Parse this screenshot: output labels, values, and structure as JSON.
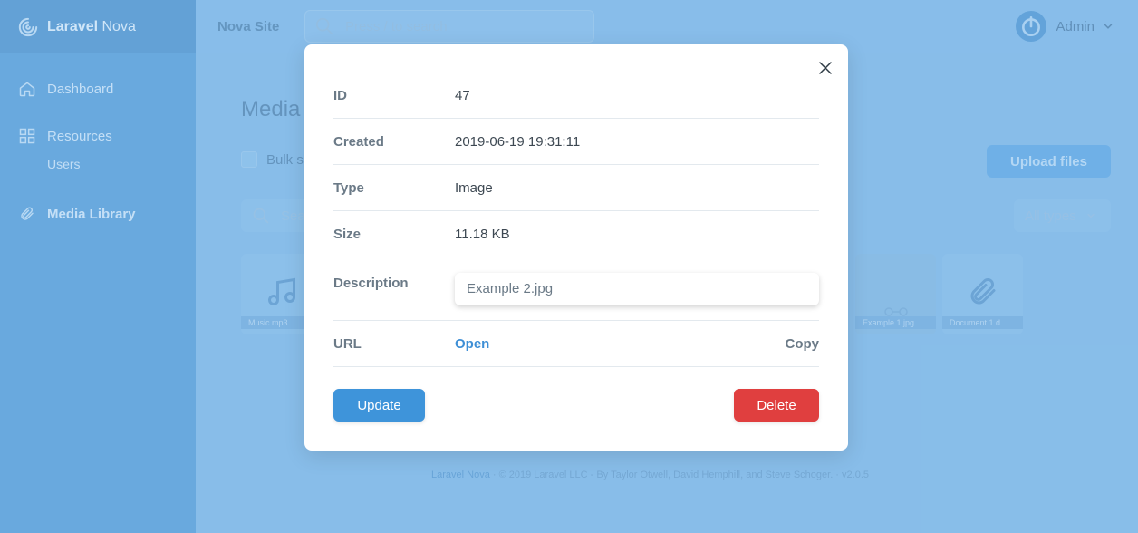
{
  "app": {
    "brand_bold": "Laravel",
    "brand_thin": "Nova",
    "site_name": "Nova Site",
    "search_placeholder": "Press / to search",
    "user_name": "Admin"
  },
  "sidebar": {
    "items": [
      {
        "label": "Dashboard",
        "icon": "home-icon"
      },
      {
        "label": "Resources",
        "icon": "grid-icon"
      },
      {
        "label": "Users",
        "icon": ""
      },
      {
        "label": "Media Library",
        "icon": "paperclip-icon"
      }
    ]
  },
  "library": {
    "title": "Media",
    "bulk_label": "Bulk s",
    "upload_label": "Upload files",
    "search_placeholder": "Sea",
    "type_filter": "All types",
    "tiles": [
      {
        "caption": "Music.mp3",
        "icon": "music-note-icon"
      },
      {
        "caption": "Example 1.jpg",
        "icon": "image-icon"
      },
      {
        "caption": "Document 1.d...",
        "icon": "paperclip-icon"
      }
    ]
  },
  "footer": {
    "link": "Laravel Nova",
    "text": "·  © 2019 Laravel LLC - By Taylor Otwell, David Hemphill, and Steve Schoger.  ·  v2.0.5"
  },
  "modal": {
    "rows": [
      {
        "label": "ID",
        "value": "47"
      },
      {
        "label": "Created",
        "value": "2019-06-19 19:31:11"
      },
      {
        "label": "Type",
        "value": "Image"
      },
      {
        "label": "Size",
        "value": "11.18 KB"
      }
    ],
    "description_label": "Description",
    "description_value": "Example 2.jpg",
    "url_label": "URL",
    "open_label": "Open",
    "copy_label": "Copy",
    "update_label": "Update",
    "delete_label": "Delete"
  },
  "colors": {
    "primary": "#3e94da",
    "danger": "#e03f3f",
    "sidebar": "#4490cf"
  }
}
